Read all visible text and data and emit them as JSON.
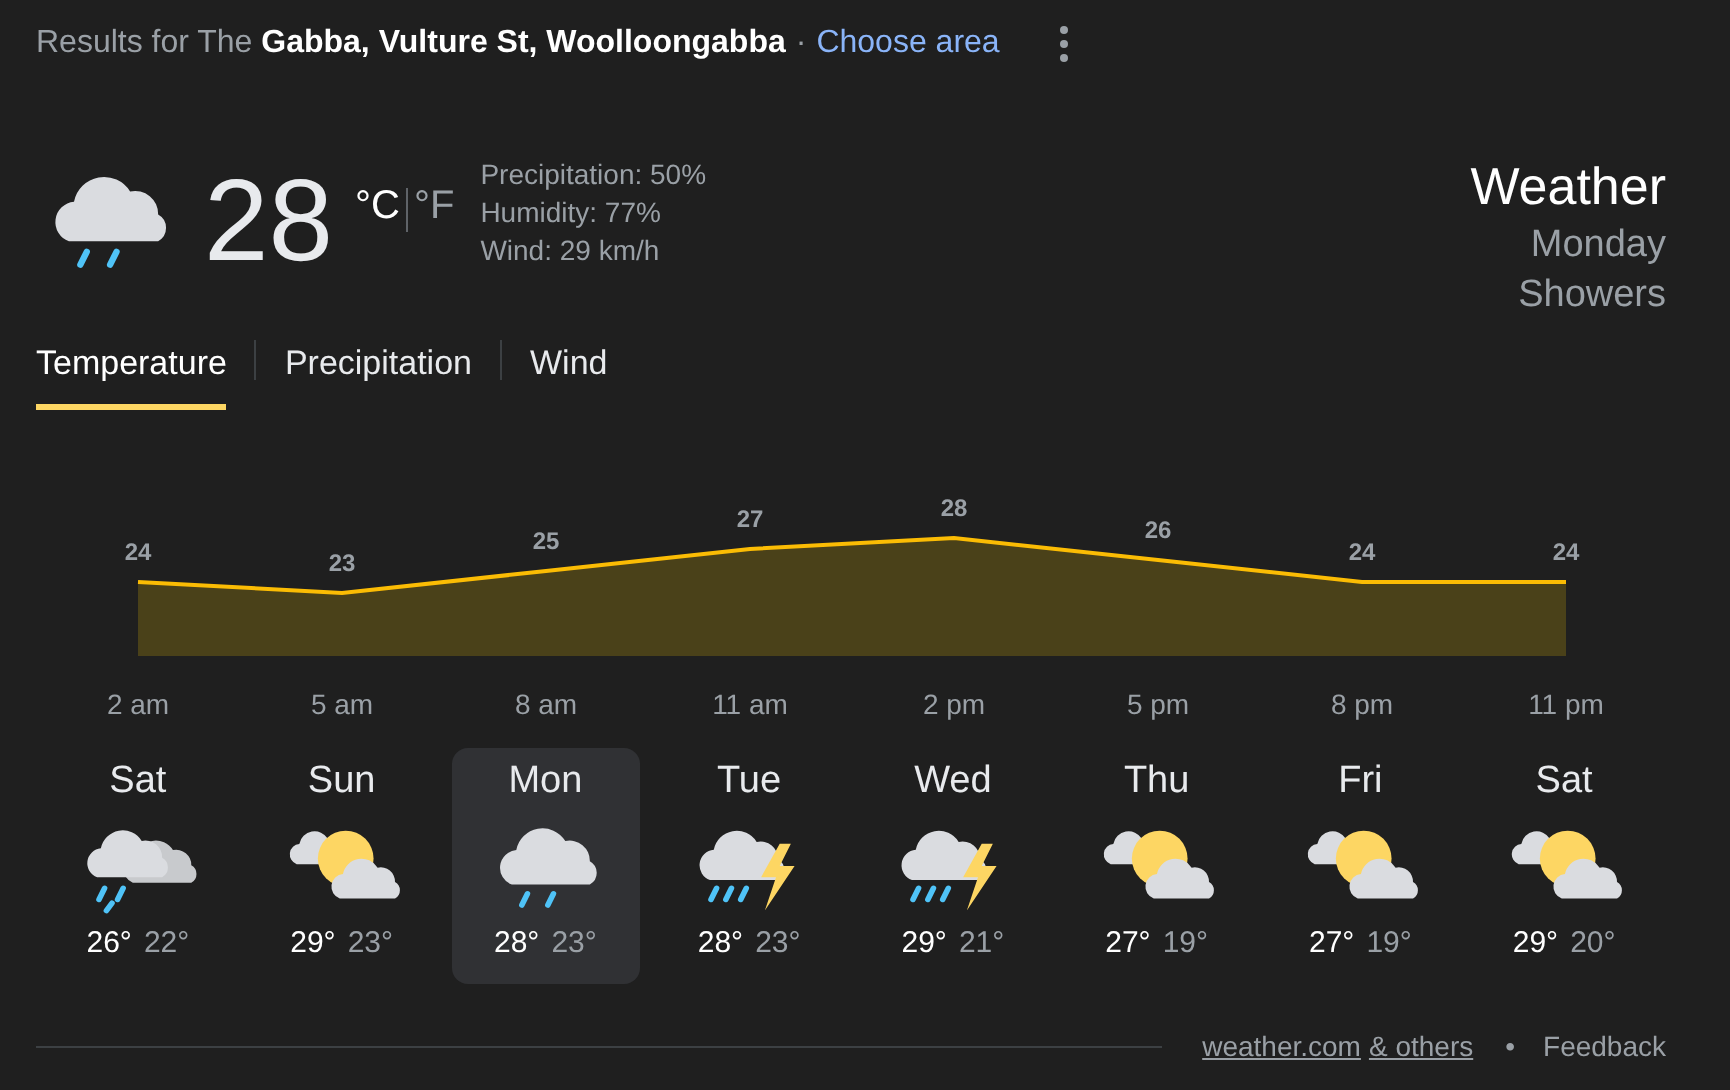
{
  "header": {
    "location": "Results for The **Gabba, Vulture St, Woolloongabba**",
    "separator": "·",
    "link": "Choose area"
  },
  "current": {
    "kind": "showers",
    "temperature": "28",
    "units": [
      {
        "label": "°C",
        "selected": true
      },
      {
        "label": "°F",
        "selected": false
      }
    ],
    "details": [
      "Precipitation: 50%",
      "Humidity: 77%",
      "Wind: 29 km/h"
    ],
    "title": "Weather",
    "day": "Monday",
    "condition": "Showers"
  },
  "tabs": [
    {
      "label": "Temperature",
      "selected": true
    },
    {
      "label": "Precipitation",
      "selected": false
    },
    {
      "label": "Wind",
      "selected": false
    }
  ],
  "chart_data": {
    "type": "area",
    "categories": [
      "2 am",
      "5 am",
      "8 am",
      "11 am",
      "2 pm",
      "5 pm",
      "8 pm",
      "11 pm"
    ],
    "values": [
      24,
      23,
      25,
      27,
      28,
      26,
      24,
      24
    ],
    "data_labels": true
  },
  "days": [
    {
      "name": "Sat",
      "kind": "showers-cloudy",
      "high": "26°",
      "low": "22°",
      "selected": false
    },
    {
      "name": "Sun",
      "kind": "partly-sunny",
      "high": "29°",
      "low": "23°",
      "selected": false
    },
    {
      "name": "Mon",
      "kind": "showers",
      "high": "28°",
      "low": "23°",
      "selected": true
    },
    {
      "name": "Tue",
      "kind": "thunderstorm",
      "high": "28°",
      "low": "23°",
      "selected": false
    },
    {
      "name": "Wed",
      "kind": "thunderstorm",
      "high": "29°",
      "low": "21°",
      "selected": false
    },
    {
      "name": "Thu",
      "kind": "partly-sunny",
      "high": "27°",
      "low": "19°",
      "selected": false
    },
    {
      "name": "Fri",
      "kind": "partly-sunny",
      "high": "27°",
      "low": "19°",
      "selected": false
    },
    {
      "name": "Sat",
      "kind": "partly-sunny",
      "high": "29°",
      "low": "20°",
      "selected": false
    }
  ],
  "footer": {
    "sources": [
      "weather.com",
      "& others"
    ],
    "separator": "•",
    "feedback": "Feedback"
  }
}
